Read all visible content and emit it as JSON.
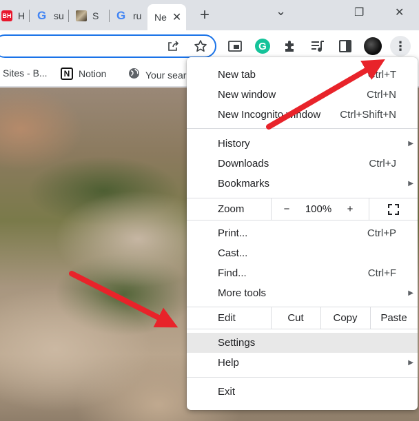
{
  "tabs": [
    {
      "favicon": "BH",
      "label": "H"
    },
    {
      "favicon": "G",
      "label": "su"
    },
    {
      "favicon": "image-favicon",
      "label": "S"
    },
    {
      "favicon": "G",
      "label": "ru"
    },
    {
      "favicon": "",
      "label": "Ne",
      "active": true
    }
  ],
  "tab_close_glyph": "✕",
  "new_tab_glyph": "+",
  "window": {
    "dropdown": "⌄",
    "restore": "❐",
    "close": "✕"
  },
  "toolbar": {
    "share_icon": "share-icon",
    "star_icon": "star-icon",
    "grammarly_letter": "G",
    "menu_glyph": "⋮"
  },
  "bookmarks": [
    {
      "label": "Sites - B..."
    },
    {
      "label": "Notion",
      "icon": "N"
    },
    {
      "label": "Your sear"
    }
  ],
  "menu": {
    "items": [
      {
        "label": "New tab",
        "shortcut": "Ctrl+T"
      },
      {
        "label": "New window",
        "shortcut": "Ctrl+N"
      },
      {
        "label": "New Incognito window",
        "shortcut": "Ctrl+Shift+N"
      },
      {
        "label": "History",
        "submenu": true
      },
      {
        "label": "Downloads",
        "shortcut": "Ctrl+J"
      },
      {
        "label": "Bookmarks",
        "submenu": true
      },
      {
        "label": "Print...",
        "shortcut": "Ctrl+P"
      },
      {
        "label": "Cast..."
      },
      {
        "label": "Find...",
        "shortcut": "Ctrl+F"
      },
      {
        "label": "More tools",
        "submenu": true
      },
      {
        "label": "Settings",
        "highlighted": true
      },
      {
        "label": "Help",
        "submenu": true
      },
      {
        "label": "Exit"
      }
    ],
    "zoom": {
      "label": "Zoom",
      "minus": "−",
      "value": "100%",
      "plus": "+"
    },
    "edit": {
      "label": "Edit",
      "cut": "Cut",
      "copy": "Copy",
      "paste": "Paste"
    },
    "submenu_glyph": "▶"
  },
  "colors": {
    "accent": "#1a73e8",
    "arrow": "#e8232a",
    "menu_highlight": "#e8e8e8",
    "grammarly": "#15c39a"
  }
}
